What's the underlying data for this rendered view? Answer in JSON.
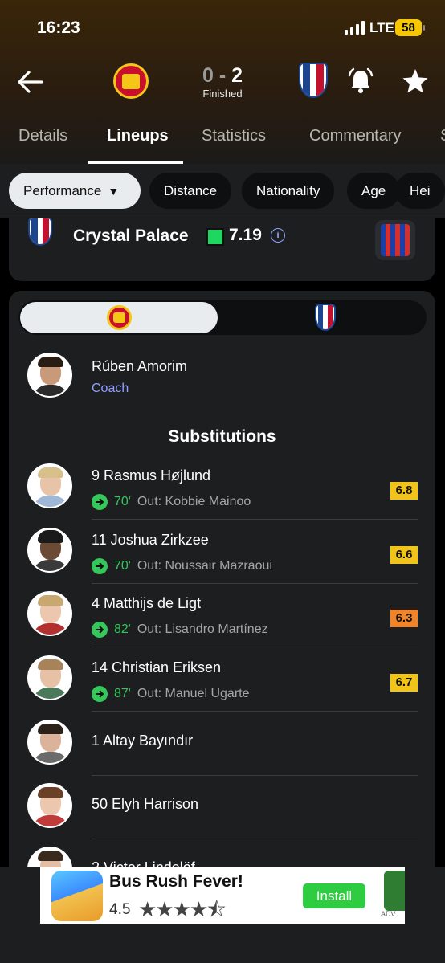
{
  "status_bar": {
    "time": "16:23",
    "network": "LTE",
    "battery": "58"
  },
  "match": {
    "home_team_icon": "manchester-united-crest",
    "away_team_icon": "crystal-palace-crest",
    "score_home": "0",
    "score_sep": " - ",
    "score_away": "2",
    "status": "Finished"
  },
  "tabs": [
    "Details",
    "Lineups",
    "Statistics",
    "Commentary",
    "S"
  ],
  "active_tab": "Lineups",
  "filters": {
    "selected": "Performance",
    "items": [
      "Distance",
      "Nationality",
      "Age",
      "Hei"
    ]
  },
  "team_card": {
    "name": "Crystal Palace",
    "rating": "7.19",
    "rating_color": "#1ed760",
    "info": "i"
  },
  "coach": {
    "name": "Rúben Amorim",
    "role": "Coach"
  },
  "substitutions": {
    "title": "Substitutions",
    "players": [
      {
        "name": "9 Rasmus Højlund",
        "minute": "70'",
        "out": "Out: Kobbie Mainoo",
        "rating": "6.8",
        "rating_color": "#f0c419"
      },
      {
        "name": "11 Joshua Zirkzee",
        "minute": "70'",
        "out": "Out: Noussair Mazraoui",
        "rating": "6.6",
        "rating_color": "#f0c419"
      },
      {
        "name": "4 Matthijs de Ligt",
        "minute": "82'",
        "out": "Out: Lisandro Martínez",
        "rating": "6.3",
        "rating_color": "#f0842a"
      },
      {
        "name": "14 Christian Eriksen",
        "minute": "87'",
        "out": "Out: Manuel Ugarte",
        "rating": "6.7",
        "rating_color": "#f0c419"
      },
      {
        "name": "1 Altay Bayındır"
      },
      {
        "name": "50 Elyh Harrison"
      },
      {
        "name": "2 Victor Lindelöf"
      }
    ]
  },
  "ad": {
    "title": "Bus Rush Fever!",
    "rating": "4.5",
    "stars": "★★★★⯪",
    "install": "Install",
    "badge": "ADV"
  }
}
